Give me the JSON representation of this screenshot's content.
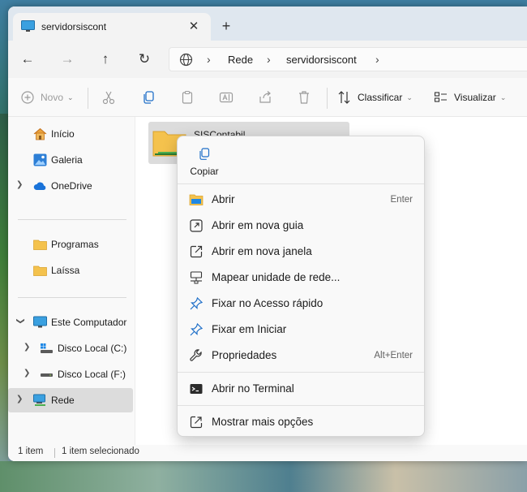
{
  "colors": {
    "accent": "#0067c0",
    "folder": "#f4c24d",
    "titlebar": "#dfe7ef"
  },
  "tab": {
    "title": "servidorsiscont",
    "close_glyph": "✕",
    "new_tab_glyph": "+"
  },
  "nav": {
    "back": "←",
    "forward": "→",
    "up": "↑",
    "refresh": "↻",
    "breadcrumb": [
      "Rede",
      "servidorsiscont"
    ],
    "separator": "›"
  },
  "toolbar": {
    "new_label": "Novo",
    "sort_label": "Classificar",
    "view_label": "Visualizar"
  },
  "sidebar": {
    "items": [
      {
        "label": "Início",
        "icon": "home-icon"
      },
      {
        "label": "Galeria",
        "icon": "gallery-icon"
      },
      {
        "label": "OneDrive",
        "icon": "cloud-icon"
      },
      {
        "label": "Programas",
        "icon": "folder-icon"
      },
      {
        "label": "Laíssa",
        "icon": "folder-icon"
      },
      {
        "label": "Este Computador",
        "icon": "computer-icon"
      },
      {
        "label": "Disco Local (C:)",
        "icon": "drive-c-icon"
      },
      {
        "label": "Disco Local (F:)",
        "icon": "drive-icon"
      },
      {
        "label": "Rede",
        "icon": "network-icon"
      }
    ]
  },
  "content": {
    "folder_name": "SISContabil"
  },
  "status": {
    "count": "1 item",
    "selection": "1 item selecionado"
  },
  "context_menu": {
    "quick_action": "Copiar",
    "items": [
      {
        "label": "Abrir",
        "accel": "Enter",
        "icon": "open-folder-icon"
      },
      {
        "label": "Abrir em nova guia",
        "accel": "",
        "icon": "new-tab-icon"
      },
      {
        "label": "Abrir em nova janela",
        "accel": "",
        "icon": "new-window-icon"
      },
      {
        "label": "Mapear unidade de rede...",
        "accel": "",
        "icon": "map-drive-icon"
      },
      {
        "label": "Fixar no Acesso rápido",
        "accel": "",
        "icon": "pin-icon"
      },
      {
        "label": "Fixar em Iniciar",
        "accel": "",
        "icon": "pin-start-icon"
      },
      {
        "label": "Propriedades",
        "accel": "Alt+Enter",
        "icon": "wrench-icon"
      },
      {
        "label": "Abrir no Terminal",
        "accel": "",
        "icon": "terminal-icon"
      },
      {
        "label": "Mostrar mais opções",
        "accel": "",
        "icon": "more-options-icon"
      }
    ]
  }
}
